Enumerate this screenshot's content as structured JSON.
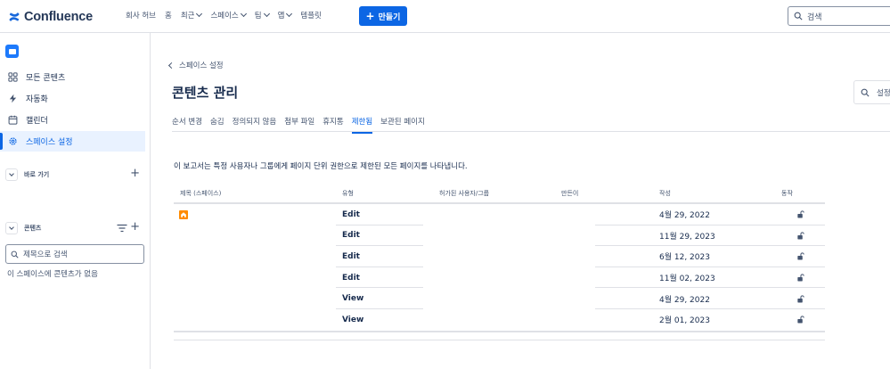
{
  "topnav": {
    "logo_text": "Confluence",
    "items": [
      {
        "label": "회사 허브",
        "dropdown": false
      },
      {
        "label": "홈",
        "dropdown": false
      },
      {
        "label": "최근",
        "dropdown": true
      },
      {
        "label": "스페이스",
        "dropdown": true
      },
      {
        "label": "팀",
        "dropdown": true
      },
      {
        "label": "앱",
        "dropdown": true
      },
      {
        "label": "템플릿",
        "dropdown": false
      }
    ],
    "create_label": "만들기",
    "search_placeholder": "검색"
  },
  "sidebar": {
    "items": [
      {
        "label": "모든 콘텐츠",
        "icon": "grid-icon",
        "active": false
      },
      {
        "label": "자동화",
        "icon": "lightning-icon",
        "active": false
      },
      {
        "label": "캘린더",
        "icon": "calendar-icon",
        "active": false
      },
      {
        "label": "스페이스 설정",
        "icon": "gear-icon",
        "active": true
      }
    ],
    "shortcuts_label": "바로 가기",
    "content_label": "콘텐츠",
    "search_placeholder": "제목으로 검색",
    "empty_text": "이 스페이스에 콘텐츠가 없음"
  },
  "main": {
    "back_label": "스페이스 설정",
    "title": "콘텐츠 관리",
    "settings_label": "설정",
    "tabs": [
      {
        "label": "순서 변경",
        "active": false
      },
      {
        "label": "숨김",
        "active": false
      },
      {
        "label": "정의되지 않음",
        "active": false
      },
      {
        "label": "첨부 파일",
        "active": false
      },
      {
        "label": "휴지통",
        "active": false
      },
      {
        "label": "제한됨",
        "active": true
      },
      {
        "label": "보관된 페이지",
        "active": false
      }
    ],
    "description": "이 보고서는 특정 사용자나 그룹에게 페이지 단위 권한으로 제한된 모든 페이지를 나타냅니다.",
    "table": {
      "headers": {
        "title": "제목 (스페이스)",
        "type": "유형",
        "allowed": "허가된 사용자/그룹",
        "creator": "만든이",
        "created": "작성",
        "action": "동작"
      },
      "rows": [
        {
          "type": "Edit",
          "date": "4월 29, 2022"
        },
        {
          "type": "Edit",
          "date": "11월 29, 2023"
        },
        {
          "type": "Edit",
          "date": "6월 12, 2023"
        },
        {
          "type": "Edit",
          "date": "11월 02, 2023"
        },
        {
          "type": "View",
          "date": "4월 29, 2022"
        },
        {
          "type": "View",
          "date": "2월 01, 2023"
        }
      ]
    }
  },
  "colors": {
    "brand": "#0c66e4",
    "space_icon": "#1d7afc",
    "home_icon": "#ff8b00"
  }
}
